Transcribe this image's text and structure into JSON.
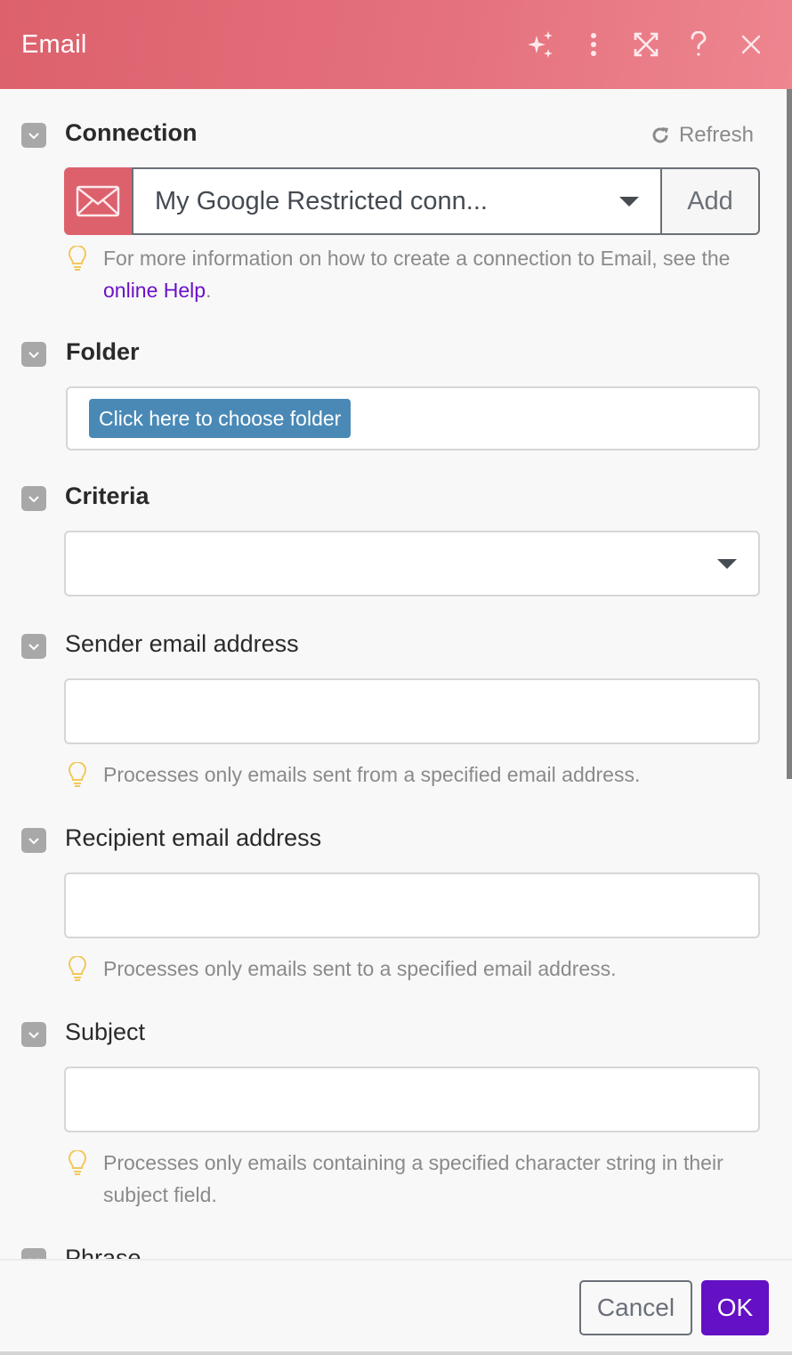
{
  "header": {
    "title": "Email",
    "icons": [
      "sparkle-icon",
      "more-vertical-icon",
      "expand-icon",
      "help-icon",
      "close-icon"
    ]
  },
  "colors": {
    "header_start": "#dc616d",
    "header_end": "#ee858f",
    "link": "#6a12c8",
    "folder_button": "#4a89b6",
    "ok_button": "#6410c4",
    "hint_icon": "#f2c85b"
  },
  "connection": {
    "label": "Connection",
    "refresh_label": "Refresh",
    "selected": "My Google Restricted conn...",
    "add_label": "Add",
    "hint_prefix": "For more information on how to create a connection to Email, see the ",
    "hint_link": "online Help",
    "hint_suffix": "."
  },
  "folder": {
    "label": "Folder",
    "button_label": "Click here to choose folder"
  },
  "criteria": {
    "label": "Criteria",
    "selected": ""
  },
  "sender": {
    "label": "Sender email address",
    "value": "",
    "hint": "Processes only emails sent from a specified email address."
  },
  "recipient": {
    "label": "Recipient email address",
    "value": "",
    "hint": "Processes only emails sent to a specified email address."
  },
  "subject": {
    "label": "Subject",
    "value": "",
    "hint": "Processes only emails containing a specified character string in their subject field."
  },
  "phrase": {
    "label": "Phrase"
  },
  "footer": {
    "cancel_label": "Cancel",
    "ok_label": "OK"
  }
}
